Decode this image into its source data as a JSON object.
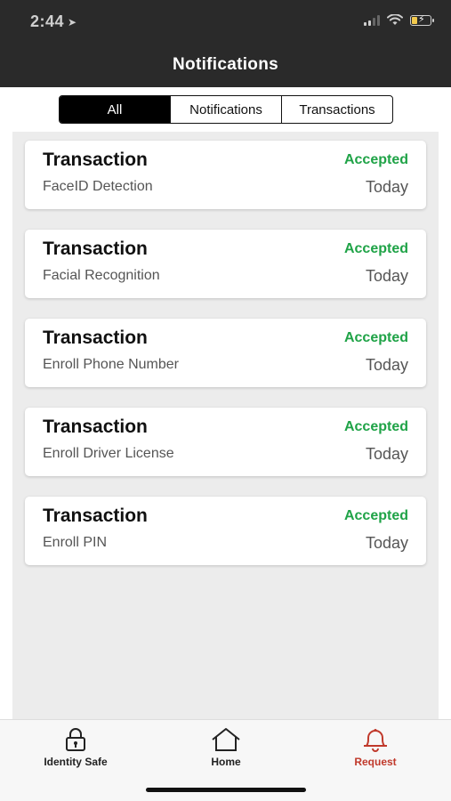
{
  "status_bar": {
    "time": "2:44"
  },
  "header": {
    "title": "Notifications"
  },
  "segments": [
    {
      "label": "All",
      "active": true
    },
    {
      "label": "Notifications",
      "active": false
    },
    {
      "label": "Transactions",
      "active": false
    }
  ],
  "items": [
    {
      "title": "Transaction",
      "subtitle": "FaceID Detection",
      "status": "Accepted",
      "date": "Today"
    },
    {
      "title": "Transaction",
      "subtitle": "Facial Recognition",
      "status": "Accepted",
      "date": "Today"
    },
    {
      "title": "Transaction",
      "subtitle": "Enroll Phone Number",
      "status": "Accepted",
      "date": "Today"
    },
    {
      "title": "Transaction",
      "subtitle": "Enroll Driver License",
      "status": "Accepted",
      "date": "Today"
    },
    {
      "title": "Transaction",
      "subtitle": "Enroll PIN",
      "status": "Accepted",
      "date": "Today"
    }
  ],
  "tabbar": [
    {
      "label": "Identity Safe",
      "icon": "lock-icon",
      "active": false
    },
    {
      "label": "Home",
      "icon": "home-icon",
      "active": false
    },
    {
      "label": "Request",
      "icon": "bell-icon",
      "active": true
    }
  ],
  "colors": {
    "header_bg": "#2a2a2a",
    "accepted": "#1fa347",
    "active_tab": "#c0392b"
  }
}
